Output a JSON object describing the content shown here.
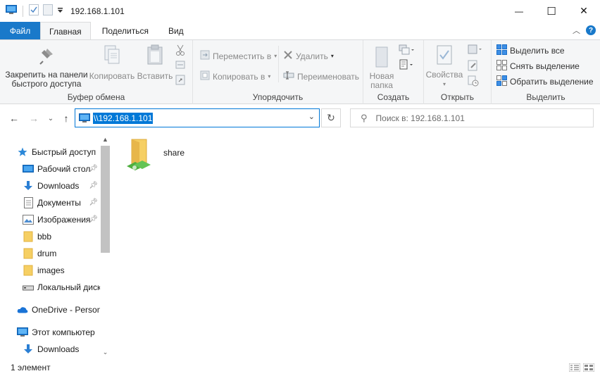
{
  "window": {
    "title": "192.168.1.101",
    "minimize_glyph": "—",
    "maximize_glyph": "☐",
    "close_glyph": "✕"
  },
  "tabs": [
    {
      "label": "Файл"
    },
    {
      "label": "Главная"
    },
    {
      "label": "Поделиться"
    },
    {
      "label": "Вид"
    }
  ],
  "ribbon": {
    "clipboard": {
      "pin_label_1": "Закрепить на панели",
      "pin_label_2": "быстрого доступа",
      "copy_label": "Копировать",
      "paste_label": "Вставить",
      "group_label": "Буфер обмена"
    },
    "organize": {
      "move_label": "Переместить в",
      "copy_to_label": "Копировать в",
      "delete_label": "Удалить",
      "rename_label": "Переименовать",
      "group_label": "Упорядочить"
    },
    "new": {
      "new_folder_1": "Новая",
      "new_folder_2": "папка",
      "group_label": "Создать"
    },
    "open": {
      "properties_label": "Свойства",
      "group_label": "Открыть"
    },
    "select": {
      "select_all": "Выделить все",
      "select_none": "Снять выделение",
      "invert": "Обратить выделение",
      "group_label": "Выделить"
    }
  },
  "address": {
    "path": "\\\\192.168.1.101",
    "search_placeholder": "Поиск в: 192.168.1.101"
  },
  "nav_pane": {
    "items": [
      {
        "label": "Быстрый доступ",
        "icon": "star-icon"
      },
      {
        "label": "Рабочий стол",
        "icon": "desktop-icon",
        "pinned": true
      },
      {
        "label": "Downloads",
        "icon": "download-icon",
        "pinned": true
      },
      {
        "label": "Документы",
        "icon": "document-icon",
        "pinned": true
      },
      {
        "label": "Изображения",
        "icon": "picture-icon",
        "pinned": true
      },
      {
        "label": "bbb",
        "icon": "folder-icon"
      },
      {
        "label": "drum",
        "icon": "folder-icon"
      },
      {
        "label": "images",
        "icon": "folder-icon"
      },
      {
        "label": "Локальный диск",
        "icon": "drive-icon"
      },
      {
        "label": "OneDrive - Personal",
        "icon": "cloud-icon"
      },
      {
        "label": "Этот компьютер",
        "icon": "computer-icon"
      },
      {
        "label": "Downloads",
        "icon": "download-icon"
      }
    ]
  },
  "content": {
    "items": [
      {
        "name": "share",
        "icon": "shared-folder-icon"
      }
    ]
  },
  "status": {
    "count": "1 элемент"
  },
  "colors": {
    "accent": "#1979ca",
    "selection": "#0078d7",
    "folder": "#f6cf63"
  }
}
